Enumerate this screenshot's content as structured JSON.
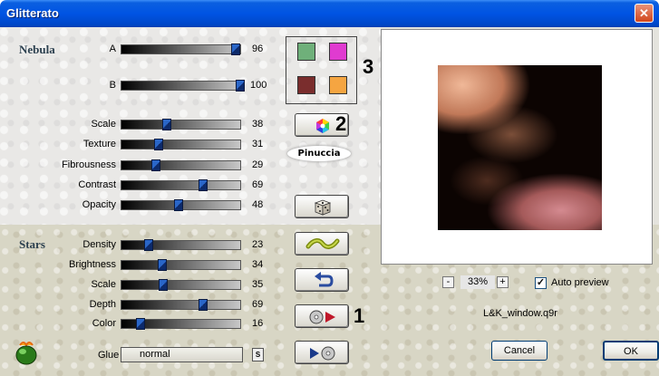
{
  "window": {
    "title": "Glitterato",
    "close_glyph": "✕"
  },
  "nebula": {
    "label": "Nebula",
    "sliders": [
      {
        "label": "A",
        "value": 96
      },
      {
        "label": "B",
        "value": 100
      },
      {
        "label": "Scale",
        "value": 38
      },
      {
        "label": "Texture",
        "value": 31
      },
      {
        "label": "Fibrousness",
        "value": 29
      },
      {
        "label": "Contrast",
        "value": 69
      },
      {
        "label": "Opacity",
        "value": 48
      }
    ]
  },
  "stars": {
    "label": "Stars",
    "sliders": [
      {
        "label": "Density",
        "value": 23
      },
      {
        "label": "Brightness",
        "value": 34
      },
      {
        "label": "Scale",
        "value": 35
      },
      {
        "label": "Depth",
        "value": 69
      },
      {
        "label": "Color",
        "value": 16
      }
    ]
  },
  "colors": {
    "swatch1": "#6fb07a",
    "swatch2": "#e03bd0",
    "swatch3": "#7a2d2d",
    "swatch4": "#f5a541",
    "accent": "#0054e3"
  },
  "annotations": {
    "n3": "3",
    "n2": "2",
    "n1": "1"
  },
  "watermark": "Pinuccia",
  "glue": {
    "label": "Glue",
    "value": "normal",
    "button": "S"
  },
  "preview": {
    "zoom_minus": "-",
    "zoom_value": "33%",
    "zoom_plus": "+",
    "auto_preview_label": "Auto preview",
    "auto_preview_checked": "✓",
    "filename": "L&K_window.q9r"
  },
  "buttons": {
    "cancel": "Cancel",
    "ok": "OK"
  },
  "icons": [
    "color-wheel-icon",
    "dice-icon",
    "wave-icon",
    "undo-arrow-icon",
    "play-disk-icon",
    "play-left-disk-icon",
    "glue-gem-icon"
  ]
}
